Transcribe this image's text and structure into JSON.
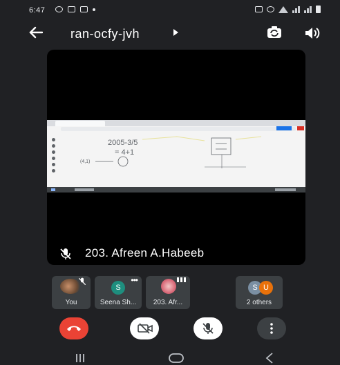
{
  "status_bar": {
    "time": "6:47"
  },
  "header": {
    "meeting_code": "ran-ocfy-jvh"
  },
  "main_video": {
    "presenter_name": "203. Afreen A.Habeeb",
    "shared_screen_text": [
      "2005-3/5",
      "= 4+1",
      "(4,1)"
    ]
  },
  "participants": [
    {
      "label": "You"
    },
    {
      "label": "Seena Sh...",
      "initial": "S"
    },
    {
      "label": "203. Afr..."
    },
    {
      "label": "2 others",
      "initials": [
        "S",
        "U"
      ]
    }
  ],
  "colors": {
    "background": "#202124",
    "tile": "#3c4043",
    "end_call": "#ea4335",
    "avatar_teal": "#1e8e7e",
    "avatar_grey": "#7a8fa3",
    "avatar_orange": "#e8710a"
  },
  "icons": {
    "back": "arrow-left-icon",
    "switch_camera": "switch-camera-icon",
    "speaker": "speaker-icon",
    "mic_off": "mic-off-icon",
    "camera_off": "camera-off-icon",
    "end_call": "end-call-icon",
    "more": "more-vert-icon"
  }
}
